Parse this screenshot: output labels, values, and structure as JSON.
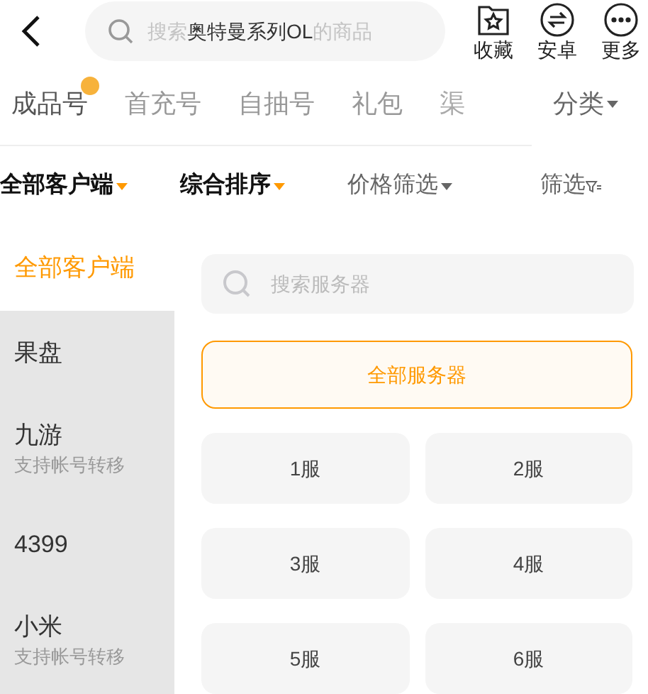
{
  "header": {
    "search": {
      "prefix": "搜索",
      "game": "奥特曼系列OL",
      "suffix": "的商品"
    },
    "actions": [
      {
        "label": "收藏",
        "kind": "star"
      },
      {
        "label": "安卓",
        "kind": "swap"
      },
      {
        "label": "更多",
        "kind": "more"
      }
    ]
  },
  "tabs": [
    {
      "label": "成品号",
      "selected": true,
      "badge": true
    },
    {
      "label": "首充号",
      "selected": false,
      "badge": false
    },
    {
      "label": "自抽号",
      "selected": false,
      "badge": false
    },
    {
      "label": "礼包",
      "selected": false,
      "badge": false
    },
    {
      "label": "渠",
      "selected": false,
      "badge": false
    }
  ],
  "category": {
    "label": "分类"
  },
  "filters": [
    {
      "label": "全部客户端",
      "active": true,
      "kind": "dropdown"
    },
    {
      "label": "综合排序",
      "active": true,
      "kind": "dropdown"
    },
    {
      "label": "价格筛选",
      "active": false,
      "kind": "dropdown"
    },
    {
      "label": "筛选",
      "active": false,
      "kind": "filter"
    }
  ],
  "sidebar": {
    "items": [
      {
        "label": "全部客户端",
        "selected": true
      },
      {
        "label": "果盘",
        "selected": false
      },
      {
        "label": "九游",
        "note": "支持帐号转移",
        "selected": false
      },
      {
        "label": "4399",
        "selected": false
      },
      {
        "label": "小米",
        "note": "支持帐号转移",
        "selected": false
      }
    ]
  },
  "server_search": {
    "placeholder": "搜索服务器"
  },
  "servers": [
    {
      "label": "全部服务器",
      "selected": true
    },
    {
      "label": "1服",
      "selected": false
    },
    {
      "label": "2服",
      "selected": false
    },
    {
      "label": "3服",
      "selected": false
    },
    {
      "label": "4服",
      "selected": false
    },
    {
      "label": "5服",
      "selected": false
    },
    {
      "label": "6服",
      "selected": false
    }
  ]
}
